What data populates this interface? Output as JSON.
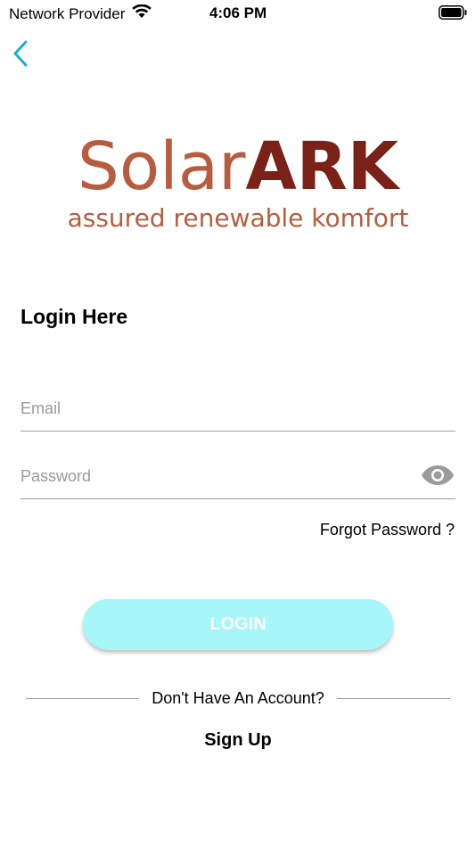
{
  "status_bar": {
    "carrier": "Network Provider",
    "time": "4:06 PM"
  },
  "icons": {
    "back": "chevron-left-icon",
    "wifi": "wifi-icon",
    "battery": "battery-icon",
    "eye": "eye-icon"
  },
  "colors": {
    "accent": "#1ab0cf",
    "logo_light": "#b85c3f",
    "logo_dark": "#7a2218",
    "button_bg": "#a6f6fa"
  },
  "logo": {
    "solar": "Solar",
    "ark": "ARK",
    "tagline": "assured renewable komfort"
  },
  "page_title": "Login Here",
  "form": {
    "email_placeholder": "Email",
    "email_value": "",
    "password_placeholder": "Password",
    "password_value": "",
    "forgot_label": "Forgot Password ?",
    "login_label": "LOGIN"
  },
  "footer": {
    "no_account": "Don't Have An Account?",
    "signup_label": "Sign Up"
  }
}
